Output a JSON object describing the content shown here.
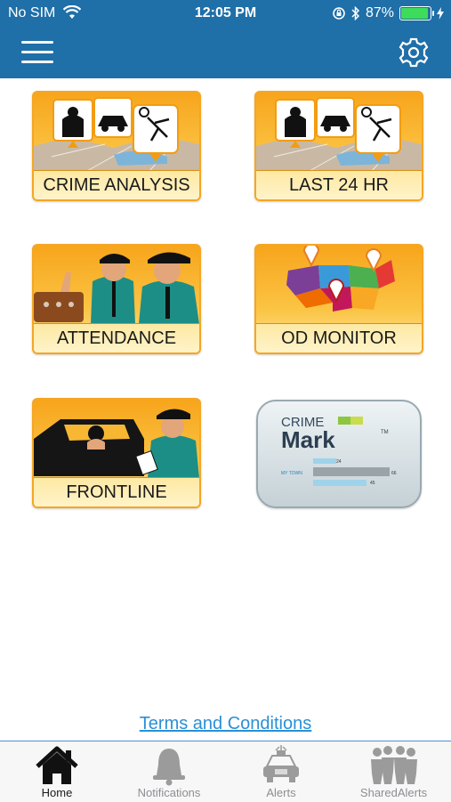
{
  "status_bar": {
    "carrier": "No SIM",
    "time": "12:05 PM",
    "battery_pct": "87%",
    "battery_level": 0.87
  },
  "header": {
    "menu_icon": "hamburger-menu-icon",
    "settings_icon": "gear-icon"
  },
  "tiles": [
    {
      "label": "CRIME ANALYSIS"
    },
    {
      "label": "LAST 24 HR"
    },
    {
      "label": "ATTENDANCE"
    },
    {
      "label": "OD MONITOR"
    },
    {
      "label": "FRONTLINE"
    },
    {
      "brand_top": "CRIME",
      "brand_main": "Mark",
      "tm": "TM",
      "row_label": "MY TOWN",
      "values": [
        "24",
        "66",
        "45"
      ]
    }
  ],
  "terms_link": "Terms and Conditions",
  "tabbar": {
    "tabs": [
      {
        "label": "Home",
        "icon": "home-icon",
        "active": true
      },
      {
        "label": "Notifications",
        "icon": "bell-icon",
        "active": false
      },
      {
        "label": "Alerts",
        "icon": "police-car-icon",
        "active": false
      },
      {
        "label": "SharedAlerts",
        "icon": "people-group-icon",
        "active": false
      }
    ]
  },
  "colors": {
    "header": "#1f6fa8",
    "tile_orange": "#f7a51c",
    "link": "#2a8fd6"
  }
}
